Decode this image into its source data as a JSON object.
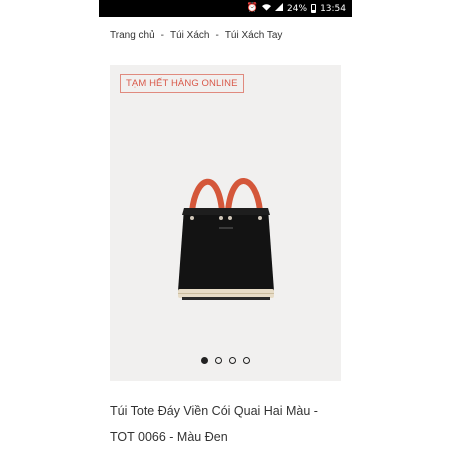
{
  "status_bar": {
    "battery": "24%",
    "time": "13:54",
    "icons": [
      "alarm-icon",
      "wifi-icon",
      "signal-icon",
      "battery-icon"
    ]
  },
  "breadcrumb": {
    "items": [
      "Trang chủ",
      "Túi Xách",
      "Túi Xách Tay"
    ],
    "separator": "-"
  },
  "product": {
    "badge": "TẠM HẾT HÀNG ONLINE",
    "image_alt": "black-tote-bag-image",
    "title_line1": "Túi Tote Đáy Viền Cói Quai Hai Màu -",
    "title_line2": "TOT 0066 - Màu Đen",
    "carousel": {
      "count": 4,
      "active_index": 1
    }
  },
  "colors": {
    "badge": "#d9594a",
    "gallery_bg": "#f1f0ef",
    "bag_body": "#111111",
    "handle": "#d4573a"
  }
}
